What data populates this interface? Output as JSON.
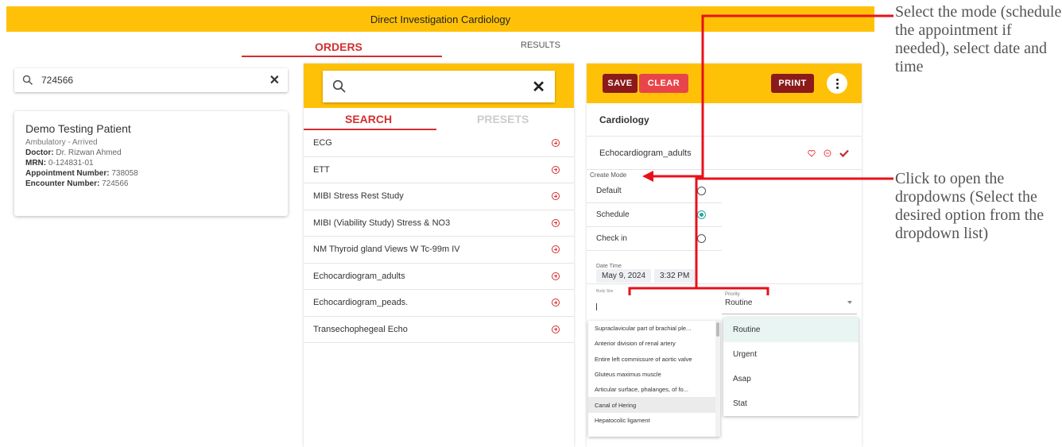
{
  "app": {
    "title": "Direct Investigation Cardiology"
  },
  "main_tabs": {
    "orders": "ORDERS",
    "results": "RESULTS"
  },
  "patient_search": {
    "value": "724566"
  },
  "patient": {
    "name": "Demo Testing Patient",
    "status": "Ambulatory - Arrived",
    "doctor_label": "Doctor:",
    "doctor": "Dr. Rizwan Ahmed",
    "mrn_label": "MRN:",
    "mrn": "0-124831-01",
    "appointment_label": "Appointment Number:",
    "appointment": "738058",
    "encounter_label": "Encounter Number:",
    "encounter": "724566"
  },
  "order_search": {
    "value": ""
  },
  "sub_tabs": {
    "search": "SEARCH",
    "presets": "PRESETS"
  },
  "tests": [
    "ECG",
    "ETT",
    "MIBI Stress Rest Study",
    "MIBI (Viability Study) Stress & NO3",
    "NM Thyroid gland Views W Tc-99m IV",
    "Echocardiogram_adults",
    "Echocardiogram_peads.",
    "Transechophegeal Echo"
  ],
  "toolbar": {
    "save": "SAVE",
    "clear": "CLEAR",
    "print": "PRINT"
  },
  "order": {
    "department": "Cardiology",
    "test": "Echocardiogram_adults",
    "create_mode_label": "Create Mode",
    "modes": [
      "Default",
      "Schedule",
      "Check in"
    ],
    "selected_mode": "Schedule",
    "date_time_label": "Date Time",
    "date": "May 9, 2024",
    "time": "3:32 PM",
    "body_site_label": "Body Site",
    "priority_label": "Priority",
    "priority_value": "Routine"
  },
  "body_site_options": [
    "Supraclavicular part of brachial ple...",
    "Anterior division of renal artery",
    "Entire left commissure of aortic valve",
    "Gluteus maximus muscle",
    "Articular surface, phalanges, of fo...",
    "Canal of Hering",
    "Hepatocolic ligament"
  ],
  "highlighted_body_site": "Canal of Hering",
  "priority_options": [
    "Routine",
    "Urgent",
    "Asap",
    "Stat"
  ],
  "annotations": {
    "mode": "Select the mode (schedule the appointment if needed), select date and time",
    "dropdowns": "Click to open the dropdowns (Select the desired option from the dropdown list)"
  },
  "colors": {
    "accent": "#FFC107",
    "primary_red": "#D32F2F",
    "dark_red": "#8B1A1A",
    "light_red": "#E8454A",
    "teal": "#26A69A",
    "annotation_red": "#E8101A"
  }
}
